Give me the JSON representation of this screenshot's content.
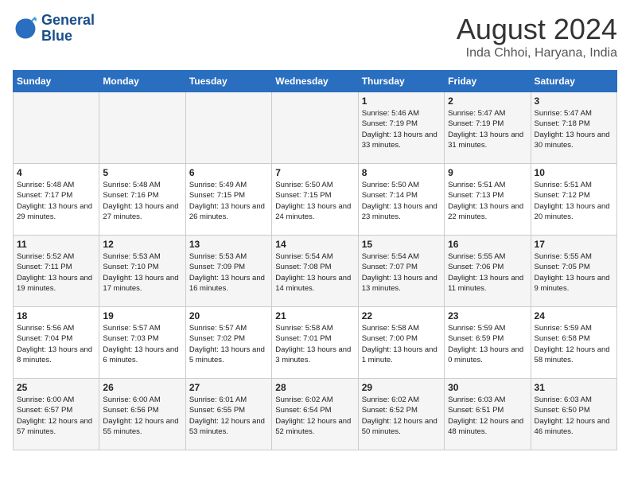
{
  "logo": {
    "line1": "General",
    "line2": "Blue"
  },
  "title": "August 2024",
  "location": "Inda Chhoi, Haryana, India",
  "days_header": [
    "Sunday",
    "Monday",
    "Tuesday",
    "Wednesday",
    "Thursday",
    "Friday",
    "Saturday"
  ],
  "weeks": [
    [
      {
        "day": "",
        "empty": true
      },
      {
        "day": "",
        "empty": true
      },
      {
        "day": "",
        "empty": true
      },
      {
        "day": "",
        "empty": true
      },
      {
        "day": "1",
        "sunrise": "5:46 AM",
        "sunset": "7:19 PM",
        "daylight": "13 hours and 33 minutes."
      },
      {
        "day": "2",
        "sunrise": "5:47 AM",
        "sunset": "7:19 PM",
        "daylight": "13 hours and 31 minutes."
      },
      {
        "day": "3",
        "sunrise": "5:47 AM",
        "sunset": "7:18 PM",
        "daylight": "13 hours and 30 minutes."
      }
    ],
    [
      {
        "day": "4",
        "sunrise": "5:48 AM",
        "sunset": "7:17 PM",
        "daylight": "13 hours and 29 minutes."
      },
      {
        "day": "5",
        "sunrise": "5:48 AM",
        "sunset": "7:16 PM",
        "daylight": "13 hours and 27 minutes."
      },
      {
        "day": "6",
        "sunrise": "5:49 AM",
        "sunset": "7:15 PM",
        "daylight": "13 hours and 26 minutes."
      },
      {
        "day": "7",
        "sunrise": "5:50 AM",
        "sunset": "7:15 PM",
        "daylight": "13 hours and 24 minutes."
      },
      {
        "day": "8",
        "sunrise": "5:50 AM",
        "sunset": "7:14 PM",
        "daylight": "13 hours and 23 minutes."
      },
      {
        "day": "9",
        "sunrise": "5:51 AM",
        "sunset": "7:13 PM",
        "daylight": "13 hours and 22 minutes."
      },
      {
        "day": "10",
        "sunrise": "5:51 AM",
        "sunset": "7:12 PM",
        "daylight": "13 hours and 20 minutes."
      }
    ],
    [
      {
        "day": "11",
        "sunrise": "5:52 AM",
        "sunset": "7:11 PM",
        "daylight": "13 hours and 19 minutes."
      },
      {
        "day": "12",
        "sunrise": "5:53 AM",
        "sunset": "7:10 PM",
        "daylight": "13 hours and 17 minutes."
      },
      {
        "day": "13",
        "sunrise": "5:53 AM",
        "sunset": "7:09 PM",
        "daylight": "13 hours and 16 minutes."
      },
      {
        "day": "14",
        "sunrise": "5:54 AM",
        "sunset": "7:08 PM",
        "daylight": "13 hours and 14 minutes."
      },
      {
        "day": "15",
        "sunrise": "5:54 AM",
        "sunset": "7:07 PM",
        "daylight": "13 hours and 13 minutes."
      },
      {
        "day": "16",
        "sunrise": "5:55 AM",
        "sunset": "7:06 PM",
        "daylight": "13 hours and 11 minutes."
      },
      {
        "day": "17",
        "sunrise": "5:55 AM",
        "sunset": "7:05 PM",
        "daylight": "13 hours and 9 minutes."
      }
    ],
    [
      {
        "day": "18",
        "sunrise": "5:56 AM",
        "sunset": "7:04 PM",
        "daylight": "13 hours and 8 minutes."
      },
      {
        "day": "19",
        "sunrise": "5:57 AM",
        "sunset": "7:03 PM",
        "daylight": "13 hours and 6 minutes."
      },
      {
        "day": "20",
        "sunrise": "5:57 AM",
        "sunset": "7:02 PM",
        "daylight": "13 hours and 5 minutes."
      },
      {
        "day": "21",
        "sunrise": "5:58 AM",
        "sunset": "7:01 PM",
        "daylight": "13 hours and 3 minutes."
      },
      {
        "day": "22",
        "sunrise": "5:58 AM",
        "sunset": "7:00 PM",
        "daylight": "13 hours and 1 minute."
      },
      {
        "day": "23",
        "sunrise": "5:59 AM",
        "sunset": "6:59 PM",
        "daylight": "13 hours and 0 minutes."
      },
      {
        "day": "24",
        "sunrise": "5:59 AM",
        "sunset": "6:58 PM",
        "daylight": "12 hours and 58 minutes."
      }
    ],
    [
      {
        "day": "25",
        "sunrise": "6:00 AM",
        "sunset": "6:57 PM",
        "daylight": "12 hours and 57 minutes."
      },
      {
        "day": "26",
        "sunrise": "6:00 AM",
        "sunset": "6:56 PM",
        "daylight": "12 hours and 55 minutes."
      },
      {
        "day": "27",
        "sunrise": "6:01 AM",
        "sunset": "6:55 PM",
        "daylight": "12 hours and 53 minutes."
      },
      {
        "day": "28",
        "sunrise": "6:02 AM",
        "sunset": "6:54 PM",
        "daylight": "12 hours and 52 minutes."
      },
      {
        "day": "29",
        "sunrise": "6:02 AM",
        "sunset": "6:52 PM",
        "daylight": "12 hours and 50 minutes."
      },
      {
        "day": "30",
        "sunrise": "6:03 AM",
        "sunset": "6:51 PM",
        "daylight": "12 hours and 48 minutes."
      },
      {
        "day": "31",
        "sunrise": "6:03 AM",
        "sunset": "6:50 PM",
        "daylight": "12 hours and 46 minutes."
      }
    ]
  ]
}
